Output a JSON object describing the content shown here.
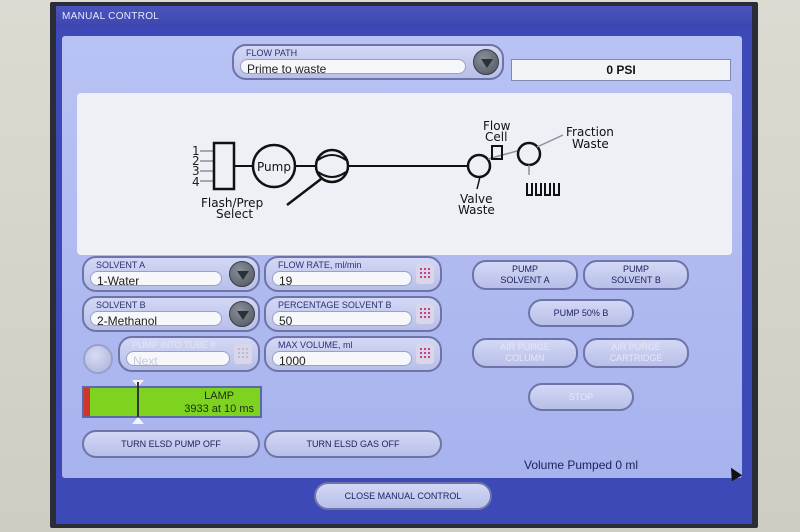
{
  "window": {
    "title": "MANUAL CONTROL"
  },
  "flow_path": {
    "label": "FLOW PATH",
    "value": "Prime to waste"
  },
  "pressure": {
    "value": "0 PSI"
  },
  "diagram": {
    "ports": [
      "1",
      "2",
      "3",
      "4"
    ],
    "pump": "Pump",
    "select_line1": "Flash/Prep",
    "select_line2": "Select",
    "flow_cell_line1": "Flow",
    "flow_cell_line2": "Cell",
    "valve": "Valve",
    "waste_bottom": "Waste",
    "fraction": "Fraction",
    "waste_top": "Waste"
  },
  "solvent_a": {
    "label": "SOLVENT A",
    "value": "1-Water"
  },
  "solvent_b": {
    "label": "SOLVENT B",
    "value": "2-Methanol"
  },
  "pump_into_tube": {
    "label": "PUMP INTO TUBE #",
    "value": "Next"
  },
  "flow_rate": {
    "label": "FLOW RATE, ml/min",
    "value": "19"
  },
  "percentage_solvent_b": {
    "label": "PERCENTAGE SOLVENT B",
    "value": "50"
  },
  "max_volume": {
    "label": "MAX VOLUME, ml",
    "value": "1000"
  },
  "buttons": {
    "pump_solvent_a_1": "PUMP",
    "pump_solvent_a_2": "SOLVENT A",
    "pump_solvent_b_1": "PUMP",
    "pump_solvent_b_2": "SOLVENT B",
    "pump_50b": "PUMP 50% B",
    "air_purge_column_1": "AIR PURGE",
    "air_purge_column_2": "COLUMN",
    "air_purge_cartridge_1": "AIR PURGE",
    "air_purge_cartridge_2": "CARTRIDGE",
    "stop": "STOP",
    "turn_elsd_pump_off": "TURN ELSD PUMP OFF",
    "turn_elsd_gas_off": "TURN ELSD GAS OFF",
    "close_manual_control": "CLOSE MANUAL CONTROL"
  },
  "lamp": {
    "label": "LAMP",
    "reading": "3933 at 10 ms",
    "level_fraction": 0.3
  },
  "volume_pumped": "Volume Pumped 0 ml",
  "colors": {
    "screen": "#3e49b8",
    "panel": "#b0baf1",
    "lamp_green": "#7ed321",
    "lamp_red": "#d0342c",
    "keypad_magenta": "#c73d8a"
  },
  "icons": {
    "dropdown": "chevron-down-icon",
    "keypad": "keypad-icon",
    "cursor": "mouse-cursor-icon"
  }
}
